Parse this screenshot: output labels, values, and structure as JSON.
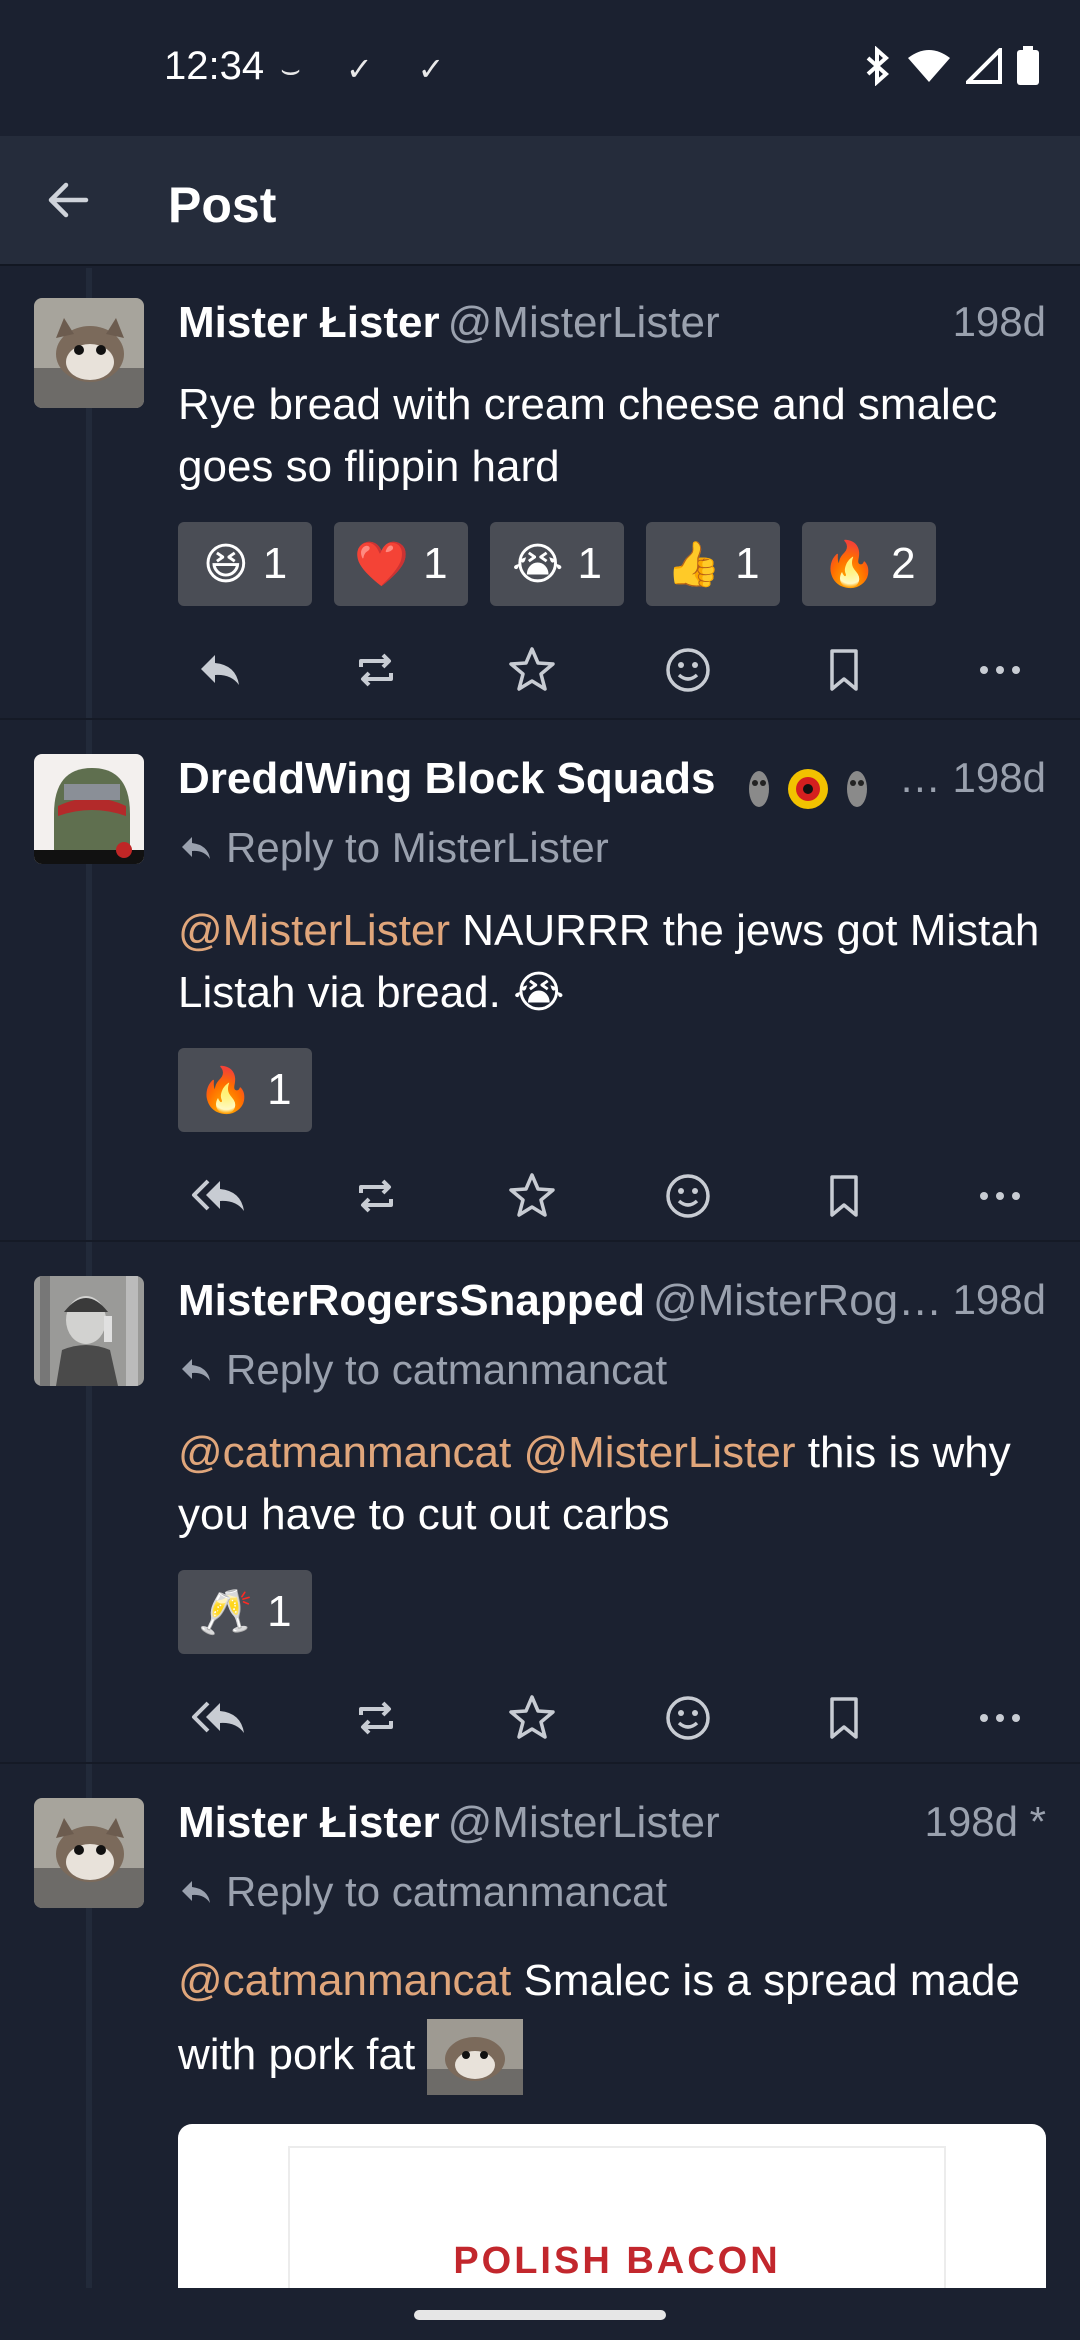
{
  "status_bar": {
    "time": "12:34",
    "left_icons": "⌣ ✓ ✓"
  },
  "app_bar": {
    "title": "Post"
  },
  "posts": [
    {
      "name": "Mister Łister",
      "handle": "@MisterLister",
      "time": "198d",
      "reply_to": "",
      "content_plain": "Rye bread with cream cheese and smalec goes so flippin hard",
      "reactions": [
        {
          "emoji": "😆",
          "count": "1"
        },
        {
          "emoji": "❤️",
          "count": "1"
        },
        {
          "emoji": "😭",
          "count": "1"
        },
        {
          "emoji": "👍",
          "count": "1"
        },
        {
          "emoji": "🔥",
          "count": "2"
        }
      ]
    },
    {
      "name": "DreddWing Block Squads",
      "handle": "",
      "time": "… 198d",
      "reply_to": "Reply to MisterLister",
      "mention_1": "@MisterLister",
      "content_rest": " NAURRR the jews got Mistah Listah via bread. 😭",
      "reactions": [
        {
          "emoji": "🔥",
          "count": "1"
        }
      ]
    },
    {
      "name": "MisterRogersSnapped",
      "handle": "@MisterRog…",
      "time": "198d",
      "reply_to": "Reply to catmanmancat",
      "mention_1": "@catmanmancat",
      "mention_2": "@MisterLister",
      "content_rest": " this is why you have to cut out carbs",
      "reactions": [
        {
          "emoji": "🥂",
          "count": "1"
        }
      ]
    },
    {
      "name": "Mister Łister",
      "handle": "@MisterLister",
      "time": "198d *",
      "reply_to": "Reply to catmanmancat",
      "mention_1": "@catmanmancat",
      "content_rest": " Smalec is a spread made with pork fat"
    }
  ],
  "link_preview": {
    "text": "POLISH BACON"
  },
  "colors": {
    "background": "#1b2130",
    "app_bar": "#252c3b",
    "mention": "#e0a67b",
    "secondary_text": "#9aa1ae",
    "chip": "#4a4d55"
  },
  "icons": {
    "back": "arrow-left-icon",
    "reply": "reply-icon",
    "reply_all": "reply-all-icon",
    "boost": "repeat-icon",
    "favourite": "star-icon",
    "emoji": "smiley-icon",
    "bookmark": "bookmark-icon",
    "more": "more-horizontal-icon"
  }
}
